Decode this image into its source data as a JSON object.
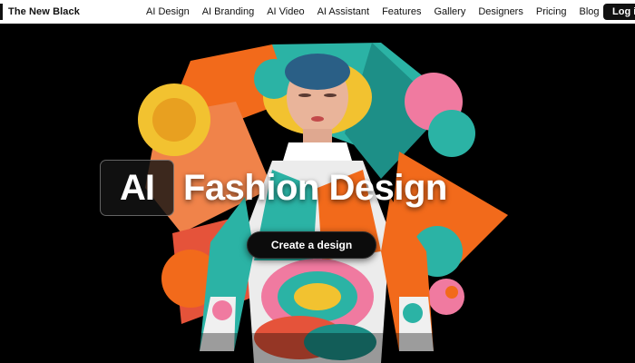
{
  "brand": {
    "name": "The New Black"
  },
  "nav": {
    "links": [
      "AI Design",
      "AI Branding",
      "AI Video",
      "AI Assistant",
      "Features",
      "Gallery",
      "Designers",
      "Pricing",
      "Blog"
    ],
    "login_label": "Log i"
  },
  "hero": {
    "headline_box": "AI",
    "headline_rest": "Fashion Design",
    "cta_label": "Create a design",
    "image_icon": "fashion-artwork-image"
  },
  "colors": {
    "nav_bg": "#ffffff",
    "hero_bg": "#000000",
    "accent_orange": "#f26a1b",
    "accent_teal": "#2bb3a5",
    "accent_pink": "#f07aa0",
    "accent_yellow": "#f2c230"
  }
}
